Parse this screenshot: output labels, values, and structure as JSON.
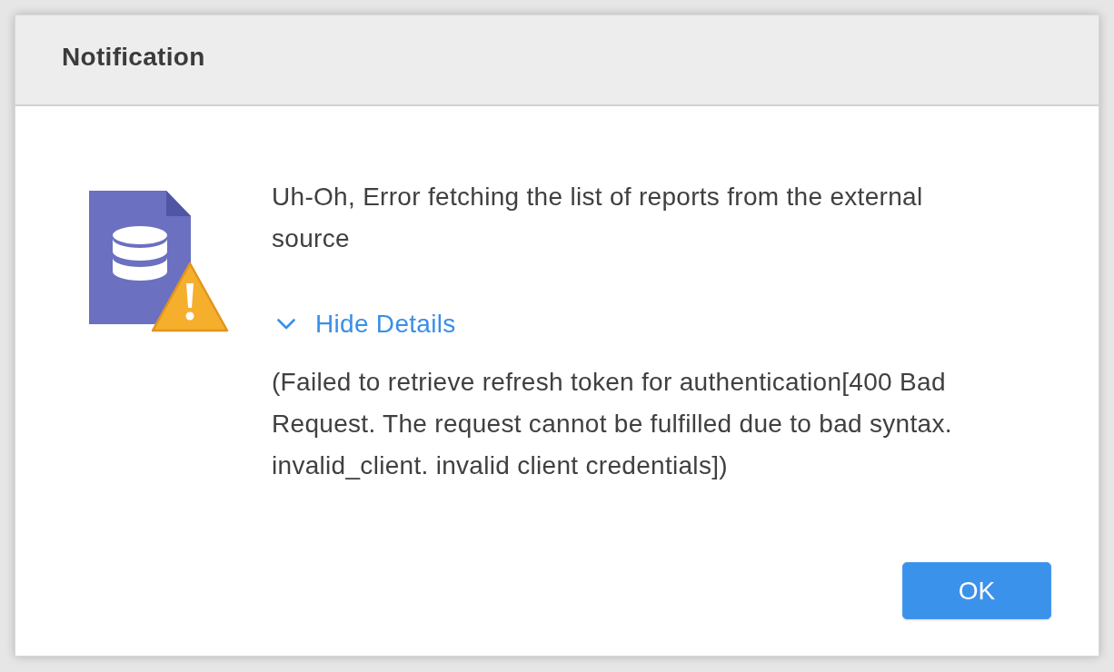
{
  "dialog": {
    "title": "Notification",
    "message": "Uh-Oh, Error fetching the list of reports from the external source",
    "details_toggle": {
      "label": "Hide Details",
      "expanded": true
    },
    "details": "(Failed to retrieve refresh token for authentication[400 Bad Request. The request cannot be fulfilled due to bad syntax. invalid_client. invalid client credentials])",
    "buttons": [
      {
        "label": "OK",
        "kind": "primary"
      }
    ]
  }
}
